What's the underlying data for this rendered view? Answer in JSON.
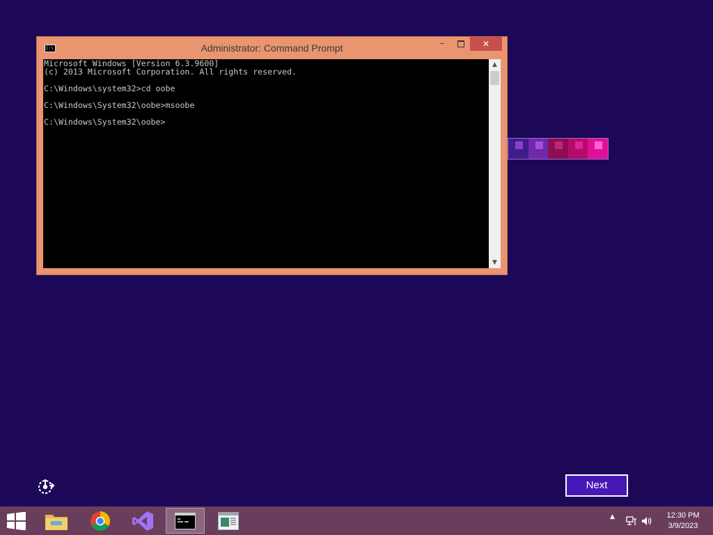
{
  "window": {
    "title": "Administrator:  Command Prompt",
    "icon_text": "C:\\",
    "minimize_label": "–",
    "close_label": "✕"
  },
  "console": {
    "lines": [
      "Microsoft Windows [Version 6.3.9600]",
      "(c) 2013 Microsoft Corporation. All rights reserved.",
      "",
      "C:\\Windows\\system32>cd oobe",
      "",
      "C:\\Windows\\System32\\oobe>msoobe",
      "",
      "C:\\Windows\\System32\\oobe>"
    ]
  },
  "scrollbar": {
    "up_arrow": "▲",
    "down_arrow": "▼"
  },
  "mosaic": {
    "tiles": [
      {
        "bg": "#3f1d8a",
        "dot": "#8a3ed1"
      },
      {
        "bg": "#6e2aa8",
        "dot": "#a34fd9"
      },
      {
        "bg": "#8f0d52",
        "dot": "#b72a7a"
      },
      {
        "bg": "#b30c6a",
        "dot": "#e0209a"
      },
      {
        "bg": "#e0109a",
        "dot": "#ff66cc"
      }
    ]
  },
  "oobe": {
    "next_label": "Next"
  },
  "taskbar": {
    "apps": [
      {
        "name": "file-explorer",
        "active": false
      },
      {
        "name": "chrome",
        "active": false
      },
      {
        "name": "visual-studio",
        "active": false
      },
      {
        "name": "command-prompt",
        "active": true
      },
      {
        "name": "app-window",
        "active": false
      }
    ],
    "tray_arrow": "▲",
    "clock_time": "12:30 PM",
    "clock_date": "3/9/2023"
  },
  "colors": {
    "desktop": "#1c0857",
    "window_frame": "#e9956f",
    "taskbar": "#6a3d5c",
    "next_button": "#4617b4",
    "close_button": "#c7504c"
  }
}
